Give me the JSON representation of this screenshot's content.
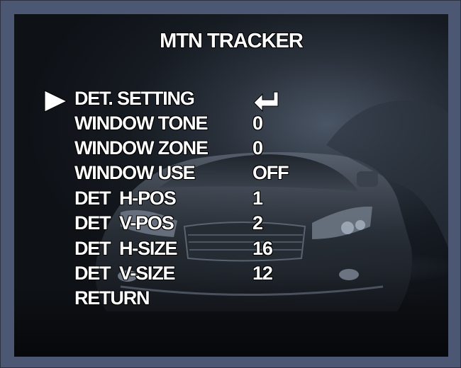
{
  "menu": {
    "title": "MTN TRACKER",
    "items": [
      {
        "label": "DET. SETTING",
        "value": "",
        "icon": "enter-arrow-icon",
        "selected": true
      },
      {
        "label": "WINDOW TONE",
        "value": "0"
      },
      {
        "label": "WINDOW ZONE",
        "value": "0"
      },
      {
        "label": "WINDOW USE",
        "value": "OFF"
      },
      {
        "label": "DET  H-POS",
        "value": "1"
      },
      {
        "label": "DET  V-POS",
        "value": "2"
      },
      {
        "label": "DET  H-SIZE",
        "value": "16"
      },
      {
        "label": "DET  V-SIZE",
        "value": "12"
      },
      {
        "label": "RETURN",
        "value": ""
      }
    ]
  },
  "colors": {
    "frame": "#4c5873",
    "text": "#ffffff"
  }
}
